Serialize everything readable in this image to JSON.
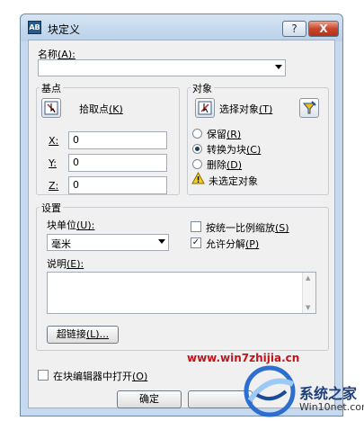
{
  "window": {
    "title": "块定义",
    "help_glyph": "?",
    "close_glyph": "X",
    "app_icon_text": "AB"
  },
  "name": {
    "label": "名称",
    "hotkey": "(A):",
    "value": ""
  },
  "base_point": {
    "title": "基点",
    "pick_label": "拾取点",
    "pick_hotkey": "(K)",
    "x_label": "X:",
    "x_value": "0",
    "y_label": "Y:",
    "y_value": "0",
    "z_label": "Z:",
    "z_value": "0"
  },
  "objects": {
    "title": "对象",
    "select_label": "选择对象",
    "select_hotkey": "(T)",
    "retain": "保留",
    "retain_hotkey": "(R)",
    "convert": "转换为块",
    "convert_hotkey": "(C)",
    "delete": "删除",
    "delete_hotkey": "(D)",
    "selected": "convert",
    "warning": "未选定对象"
  },
  "settings": {
    "title": "设置",
    "unit_label": "块单位",
    "unit_hotkey": "(U):",
    "unit_value": "毫米",
    "scale_uniform": "按统一比例缩放",
    "scale_uniform_hotkey": "(S)",
    "scale_uniform_checked": false,
    "allow_explode": "允许分解",
    "allow_explode_hotkey": "(P)",
    "allow_explode_checked": true,
    "desc_label": "说明",
    "desc_hotkey": "(E):",
    "desc_value": "",
    "hyperlink_label": "超链接",
    "hyperlink_hotkey": "(L)..."
  },
  "open_in_editor": {
    "label": "在块编辑器中打开",
    "hotkey": "(O)",
    "checked": false
  },
  "buttons": {
    "ok": "确定"
  },
  "watermark": {
    "url": "www.win7zhijia.cn",
    "brand": "系统之家",
    "site": "Win10net.com"
  }
}
